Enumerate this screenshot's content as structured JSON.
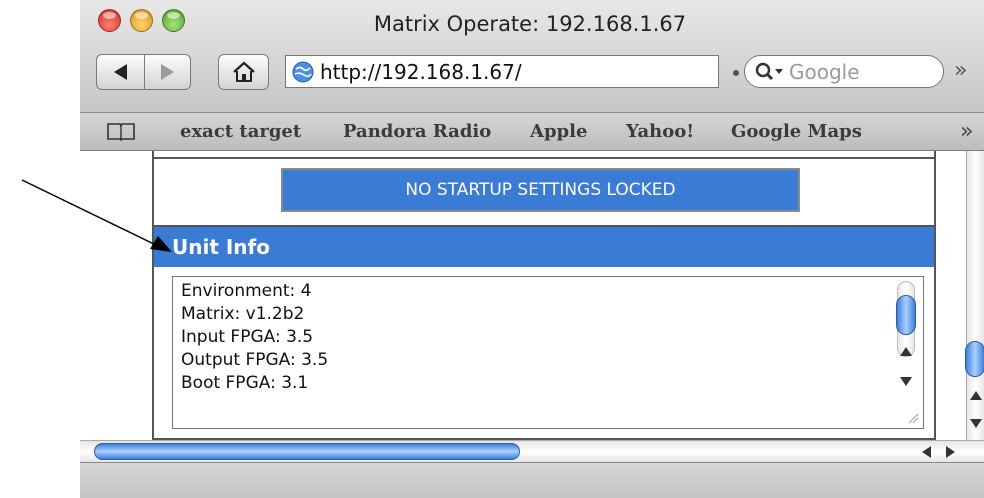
{
  "window": {
    "title": "Matrix Operate: 192.168.1.67"
  },
  "toolbar": {
    "url": "http://192.168.1.67/",
    "search_placeholder": "Google",
    "overflow_label": "»"
  },
  "bookmarks": {
    "items": [
      "exact target",
      "Pandora Radio",
      "Apple",
      "Yahoo!",
      "Google Maps"
    ],
    "overflow_label": "»"
  },
  "page": {
    "lock_banner": "NO STARTUP SETTINGS LOCKED",
    "unit_info": {
      "title": "Unit Info",
      "lines": [
        "Environment: 4",
        "Matrix: v1.2b2",
        "Input FPGA: 3.5",
        "Output FPGA: 3.5",
        "Boot FPGA: 3.1"
      ]
    }
  },
  "colors": {
    "accent_blue": "#3a7bd5",
    "scroll_thumb": "#3d7fd8"
  }
}
